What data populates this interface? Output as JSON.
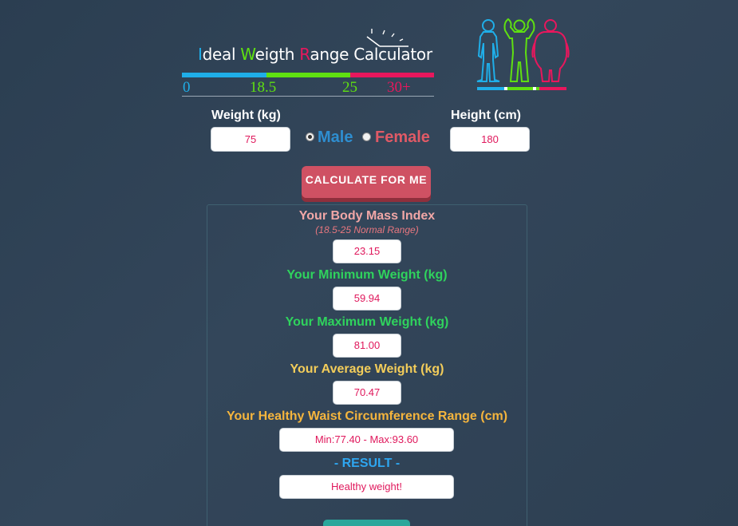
{
  "logo": {
    "title_parts": [
      {
        "text": "I",
        "accent": true,
        "color": "#1faee8"
      },
      {
        "text": "deal ",
        "accent": false
      },
      {
        "text": "W",
        "accent": true,
        "color": "#5fe011"
      },
      {
        "text": "eigth ",
        "accent": false
      },
      {
        "text": "R",
        "accent": true,
        "color": "#e8175d"
      },
      {
        "text": "ange Calculator",
        "accent": false
      }
    ],
    "scale_labels": [
      "0",
      "18.5",
      "25",
      "30+"
    ],
    "scale_colors": [
      "#1faee8",
      "#5fe011",
      "#e8175d"
    ]
  },
  "form": {
    "weight_label": "Weight (kg)",
    "weight_value": "75",
    "height_label": "Height (cm)",
    "height_value": "180",
    "gender_male": "Male",
    "gender_female": "Female",
    "selected_gender": "Male"
  },
  "calculate_button": "CALCULATE FOR ME",
  "results": {
    "bmi_label": "Your Body Mass Index",
    "bmi_note": "(18.5-25 Normal Range)",
    "bmi_value": "23.15",
    "min_label": "Your Minimum Weight (kg)",
    "min_value": "59.94",
    "max_label": "Your Maximum Weight (kg)",
    "max_value": "81.00",
    "avg_label": "Your Average Weight (kg)",
    "avg_value": "70.47",
    "waist_label": "Your Healthy Waist Circumference Range (cm)",
    "waist_value": "Min:77.40 - Max:93.60",
    "result_label": "- RESULT -",
    "result_value": "Healthy weight!"
  },
  "colors": {
    "accent_blue": "#1faee8",
    "accent_green": "#5fe011",
    "accent_red": "#e8175d",
    "value_text": "#e0185c",
    "button": "#cf5163",
    "label_pink": "#f1a7a7",
    "label_green": "#2fd35d",
    "label_yellow": "#f3cd5a",
    "label_orange": "#f5b53d",
    "label_result": "#2ea6f0"
  }
}
